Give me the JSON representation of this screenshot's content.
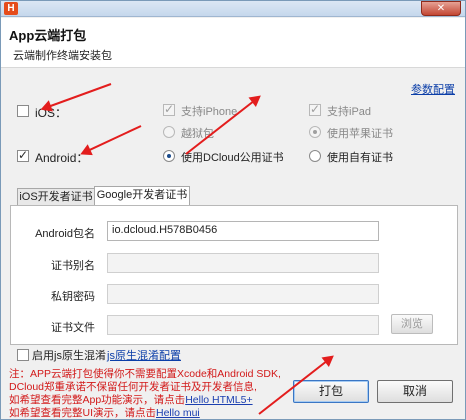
{
  "titlebar": {
    "app_icon_text": "H",
    "close_symbol": "✕"
  },
  "header": {
    "title": "App云端打包",
    "subtitle": "云端制作终端安装包"
  },
  "advanced_link": "参数配置",
  "ios": {
    "label": "iOS：",
    "checked": false,
    "support_iphone": "支持iPhone",
    "support_ipad": "支持iPad",
    "jailbreak": "越狱包",
    "use_apple_cert": "使用苹果证书"
  },
  "android": {
    "label": "Android：",
    "checked": true,
    "use_dcloud_cert": "使用DCloud公用证书",
    "use_own_cert": "使用自有证书"
  },
  "tabs": {
    "ios_cert": "iOS开发者证书",
    "google_cert": "Google开发者证书"
  },
  "form": {
    "package_name_label": "Android包名",
    "package_name_value": "io.dcloud.H578B0456",
    "alias_label": "证书别名",
    "alias_value": "",
    "key_password_label": "私钥密码",
    "key_password_value": "",
    "cert_file_label": "证书文件",
    "cert_file_value": "",
    "browse_button": "浏览"
  },
  "js_obfuscation": {
    "label": "启用js原生混淆",
    "link": "js原生混淆配置",
    "checked": false
  },
  "note": {
    "line1": "注：APP云端打包使得你不需要配置Xcode和Android SDK,",
    "line2": "DCloud郑重承诺不保留任何开发者证书及开发者信息,",
    "line3_prefix": "如希望查看完整App功能演示，请点击",
    "line3_link": "Hello HTML5+",
    "line4_prefix": "如希望查看完整UI演示，请点击",
    "line4_link": "Hello mui"
  },
  "buttons": {
    "pack": "打包",
    "cancel": "取消"
  },
  "colors": {
    "annotation_arrow": "#e31d1d",
    "note_text": "#d21919",
    "link": "#0b3ea8"
  }
}
